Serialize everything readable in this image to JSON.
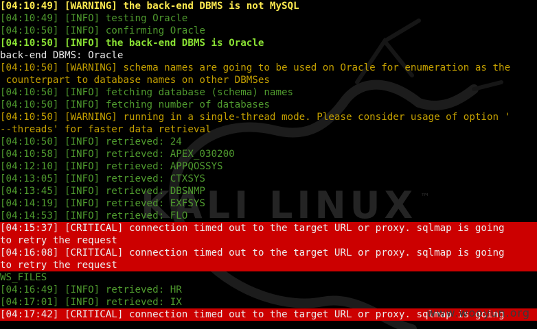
{
  "terminal": {
    "lines": [
      {
        "text": "[04:10:49] [WARNING] the back-end DBMS is not MySQL",
        "style": "bold-yellow"
      },
      {
        "text": "[04:10:49] [INFO] testing Oracle",
        "style": "info"
      },
      {
        "text": "[04:10:50] [INFO] confirming Oracle",
        "style": "info"
      },
      {
        "text": "[04:10:50] [INFO] the back-end DBMS is Oracle",
        "style": "bold-green"
      },
      {
        "text": "back-end DBMS: Oracle",
        "style": "plain"
      },
      {
        "text": "[04:10:50] [WARNING] schema names are going to be used on Oracle for enumeration as the",
        "style": "warn"
      },
      {
        "text": " counterpart to database names on other DBMSes",
        "style": "warn"
      },
      {
        "text": "[04:10:50] [INFO] fetching database (schema) names",
        "style": "info"
      },
      {
        "text": "[04:10:50] [INFO] fetching number of databases",
        "style": "info"
      },
      {
        "text": "[04:10:50] [WARNING] running in a single-thread mode. Please consider usage of option '",
        "style": "warn"
      },
      {
        "text": "--threads' for faster data retrieval",
        "style": "warn"
      },
      {
        "text": "[04:10:50] [INFO] retrieved: 24",
        "style": "info"
      },
      {
        "text": "[04:10:58] [INFO] retrieved: APEX_030200",
        "style": "info"
      },
      {
        "text": "[04:12:10] [INFO] retrieved: APPQOSSYS",
        "style": "info"
      },
      {
        "text": "[04:13:05] [INFO] retrieved: CTXSYS",
        "style": "info"
      },
      {
        "text": "[04:13:45] [INFO] retrieved: DBSNMP",
        "style": "info"
      },
      {
        "text": "[04:14:19] [INFO] retrieved: EXFSYS",
        "style": "info"
      },
      {
        "text": "[04:14:53] [INFO] retrieved: FLO",
        "style": "info"
      },
      {
        "text": "[04:15:37] [CRITICAL] connection timed out to the target URL or proxy. sqlmap is going",
        "style": "critical"
      },
      {
        "text": "to retry the request",
        "style": "critical"
      },
      {
        "text": "[04:16:08] [CRITICAL] connection timed out to the target URL or proxy. sqlmap is going",
        "style": "critical"
      },
      {
        "text": "to retry the request",
        "style": "critical"
      },
      {
        "text": "WS_FILES",
        "style": "info"
      },
      {
        "text": "[04:16:49] [INFO] retrieved: HR",
        "style": "info"
      },
      {
        "text": "[04:17:01] [INFO] retrieved: IX",
        "style": "info"
      },
      {
        "text": "[04:17:42] [CRITICAL] connection timed out to the target URL or proxy. sqlmap is going",
        "style": "critical"
      }
    ]
  },
  "background": {
    "logo_text": "KALI LINUX",
    "trademark": "™",
    "watermark": "www.wooyun.org"
  },
  "colors": {
    "info": "#4f9a2e",
    "warning": "#c4a000",
    "critical_bg": "#cc0000",
    "highlight_yellow": "#fce94f",
    "highlight_green": "#8ae234",
    "background": "#000000"
  }
}
